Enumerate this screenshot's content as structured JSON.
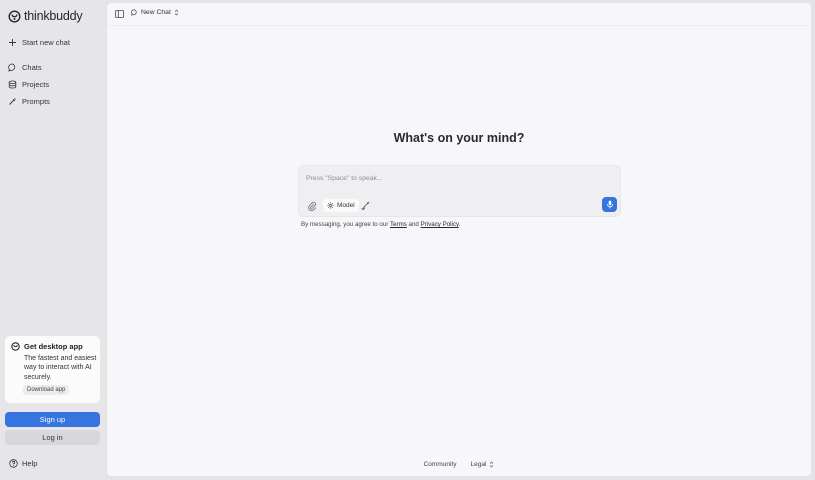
{
  "brand": {
    "name": "thinkbuddy",
    "accent_color": "#3674e0"
  },
  "sidebar": {
    "new_chat_label": "Start new chat",
    "items": [
      {
        "label": "Chats",
        "icon": "chat-bubble-icon"
      },
      {
        "label": "Projects",
        "icon": "layers-icon"
      },
      {
        "label": "Prompts",
        "icon": "sparkle-pen-icon"
      }
    ],
    "desktop_card": {
      "title": "Get desktop app",
      "description": "The fastest and easiest way to interact with AI securely.",
      "button_label": "Download app"
    },
    "signup_label": "Sign up",
    "login_label": "Log in",
    "help_label": "Help"
  },
  "topbar": {
    "chat_title": "New Chat"
  },
  "main": {
    "headline": "What's on your mind?",
    "composer": {
      "placeholder": "Press \"Space\" to speak...",
      "model_label": "Model"
    },
    "disclaimer": {
      "prefix": "By messaging, you agree to our ",
      "terms": "Terms",
      "middle": " and ",
      "privacy": "Privacy Policy",
      "suffix": "."
    }
  },
  "footer": {
    "community": "Community",
    "legal": "Legal"
  }
}
